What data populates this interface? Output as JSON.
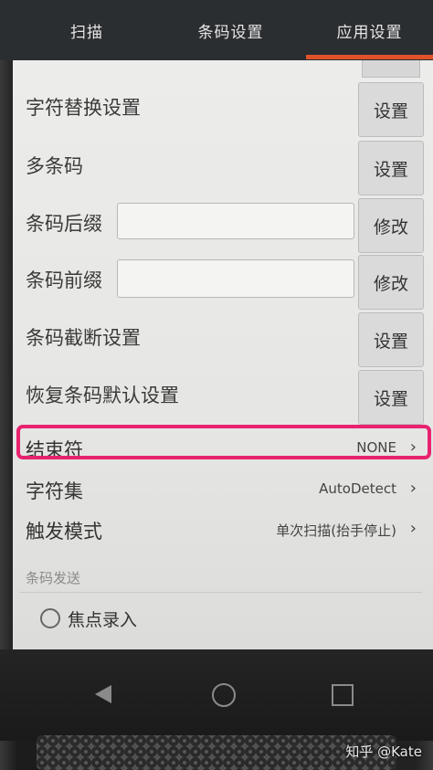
{
  "tabs": [
    {
      "label": "扫描"
    },
    {
      "label": "条码设置"
    },
    {
      "label": "应用设置"
    }
  ],
  "accent_color": "#e0522a",
  "highlight_color": "#e8226e",
  "settings": {
    "char_replace": {
      "label": "字符替换设置",
      "button": "设置"
    },
    "multi_barcode": {
      "label": "多条码",
      "button": "设置"
    },
    "suffix": {
      "label": "条码后缀",
      "value": "",
      "button": "修改"
    },
    "prefix": {
      "label": "条码前缀",
      "value": "",
      "button": "修改"
    },
    "truncate": {
      "label": "条码截断设置",
      "button": "设置"
    },
    "restore": {
      "label": "恢复条码默认设置",
      "button": "设置"
    }
  },
  "list_items": {
    "terminator": {
      "label": "结束符",
      "value": "NONE"
    },
    "charset": {
      "label": "字符集",
      "value": "AutoDetect"
    },
    "trigger": {
      "label": "触发模式",
      "value": "单次扫描(抬手停止)"
    }
  },
  "section": {
    "title": "条码发送"
  },
  "send_options": [
    {
      "label": "焦点录入",
      "selected": false
    }
  ],
  "chevron_icon": "chevron-right-icon",
  "watermark": "知乎 @Kate"
}
